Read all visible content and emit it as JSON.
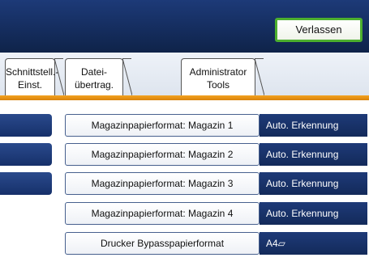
{
  "header": {
    "exit_label": "Verlassen"
  },
  "tabs": [
    {
      "label": "Schnittstell.-\nEinst."
    },
    {
      "label": "Datei-\nübertrag."
    },
    {
      "label": "Administrator\nTools"
    }
  ],
  "settings": [
    {
      "label": "Magazinpapierformat: Magazin 1",
      "value": "Auto. Erkennung"
    },
    {
      "label": "Magazinpapierformat: Magazin 2",
      "value": "Auto. Erkennung"
    },
    {
      "label": "Magazinpapierformat: Magazin 3",
      "value": "Auto. Erkennung"
    },
    {
      "label": "Magazinpapierformat: Magazin 4",
      "value": "Auto. Erkennung"
    },
    {
      "label": "Drucker Bypasspapierformat",
      "value": "A4▱"
    }
  ],
  "colors": {
    "header_bg": "#142c5c",
    "exit_border": "#4cae2e",
    "tab_accent": "#e8900f",
    "value_bg": "#132a5a"
  }
}
